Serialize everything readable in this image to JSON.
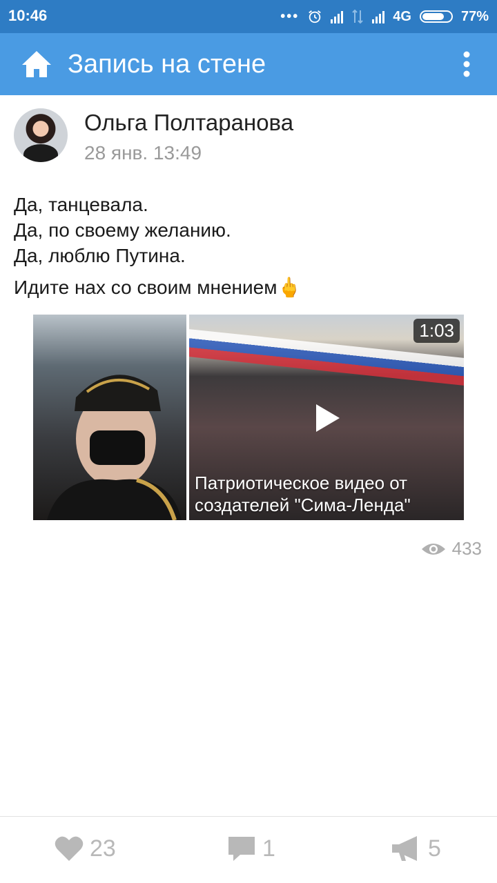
{
  "status_bar": {
    "time": "10:46",
    "network": "4G",
    "battery_percent": "77%",
    "battery_level": 0.77
  },
  "app_bar": {
    "title": "Запись на стене"
  },
  "post": {
    "author": "Ольга Полтаранова",
    "date": "28 янв. 13:49",
    "text_lines": [
      "Да, танцевала.",
      "Да, по своему желанию.",
      "Да, люблю Путина.",
      "Идите нах со своим мнением🖕"
    ],
    "video": {
      "duration": "1:03",
      "title_lines": [
        "Патриотическое видео от",
        "создателей \"Сима-Ленда\""
      ]
    },
    "views": "433"
  },
  "actions": {
    "likes": "23",
    "comments": "1",
    "reposts": "5"
  },
  "colors": {
    "status_bar": "#2e7cc4",
    "app_bar": "#4a9be3",
    "icon_grey": "#b8b8b8"
  }
}
